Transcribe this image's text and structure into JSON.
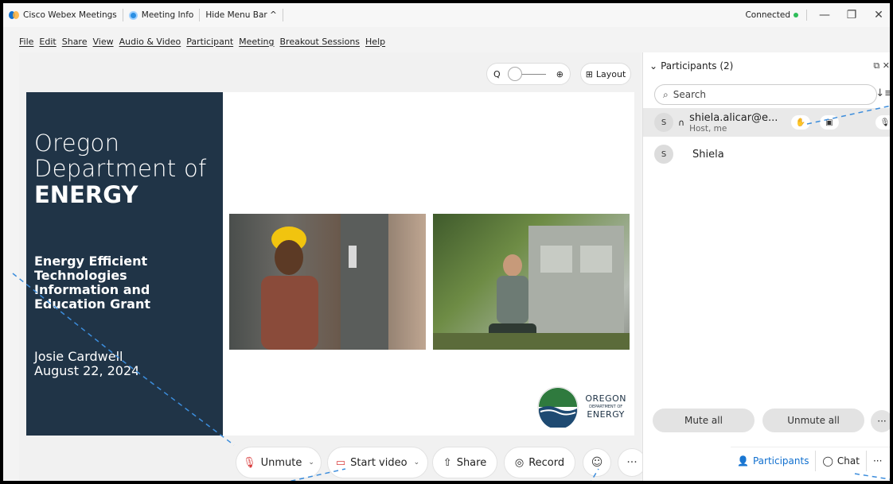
{
  "titlebar": {
    "app_name": "Cisco Webex Meetings",
    "meeting_info": "Meeting Info",
    "hide_menu": "Hide Menu Bar ^",
    "status": "Connected",
    "minimize": "—",
    "restore": "❐",
    "close": "✕"
  },
  "menubar": {
    "items": [
      "File",
      "Edit",
      "Share",
      "View",
      "Audio & Video",
      "Participant",
      "Meeting",
      "Breakout Sessions",
      "Help"
    ]
  },
  "stage": {
    "zoom_out": "Q",
    "zoom_in": "⊕",
    "layout_label": "Layout"
  },
  "slide": {
    "title_line1": "Oregon",
    "title_line2": "Department of",
    "title_line3": "ENERGY",
    "subtitle": [
      "Energy Efficient",
      "Technologies",
      "Information and",
      "Education Grant"
    ],
    "author": "Josie Cardwell",
    "date": "August 22, 2024",
    "logo_top": "OREGON",
    "logo_mid": "DEPARTMENT OF",
    "logo_bottom": "ENERGY"
  },
  "controls": {
    "unmute": "Unmute",
    "start_video": "Start video",
    "share": "Share",
    "record": "Record",
    "more": "···",
    "leave": "✕"
  },
  "participants_panel": {
    "title": "Participants (2)",
    "search_placeholder": "Search",
    "host_name": "shiela.alicar@e...",
    "host_role": "Host, me",
    "guest_name": "Shiela",
    "host_initial": "S",
    "guest_initial": "S",
    "mute_all": "Mute all",
    "unmute_all": "Unmute all",
    "more": "···",
    "tab_participants": "Participants",
    "tab_chat": "Chat",
    "tab_more": "···",
    "popout": "⧉ ✕"
  }
}
